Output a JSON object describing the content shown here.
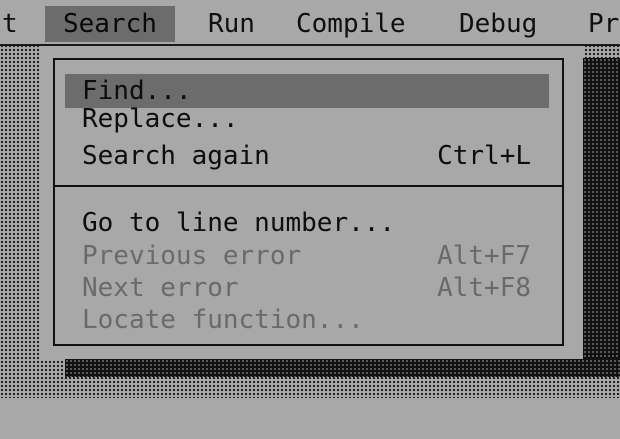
{
  "menubar": {
    "items": [
      {
        "label": "t",
        "active": false
      },
      {
        "label": "Search",
        "active": true
      },
      {
        "label": "Run",
        "active": false
      },
      {
        "label": "Compile",
        "active": false
      },
      {
        "label": "Debug",
        "active": false
      },
      {
        "label": "Pr",
        "active": false
      }
    ]
  },
  "search_menu": {
    "items": [
      {
        "label": "Find...",
        "shortcut": "",
        "state": "highlighted"
      },
      {
        "label": "Replace...",
        "shortcut": "",
        "state": "enabled"
      },
      {
        "label": "Search again",
        "shortcut": "Ctrl+L",
        "state": "enabled"
      },
      {
        "label": "Go to line number...",
        "shortcut": "",
        "state": "enabled"
      },
      {
        "label": "Previous error",
        "shortcut": "Alt+F7",
        "state": "disabled"
      },
      {
        "label": "Next error",
        "shortcut": "Alt+F8",
        "state": "disabled"
      },
      {
        "label": "Locate function...",
        "shortcut": "",
        "state": "disabled"
      }
    ]
  },
  "colors": {
    "background": "#a8a8a8",
    "highlight": "#6c6c6c",
    "text": "#0d0d0d",
    "disabled_text": "#6a6a6a",
    "shadow": "#111111"
  }
}
